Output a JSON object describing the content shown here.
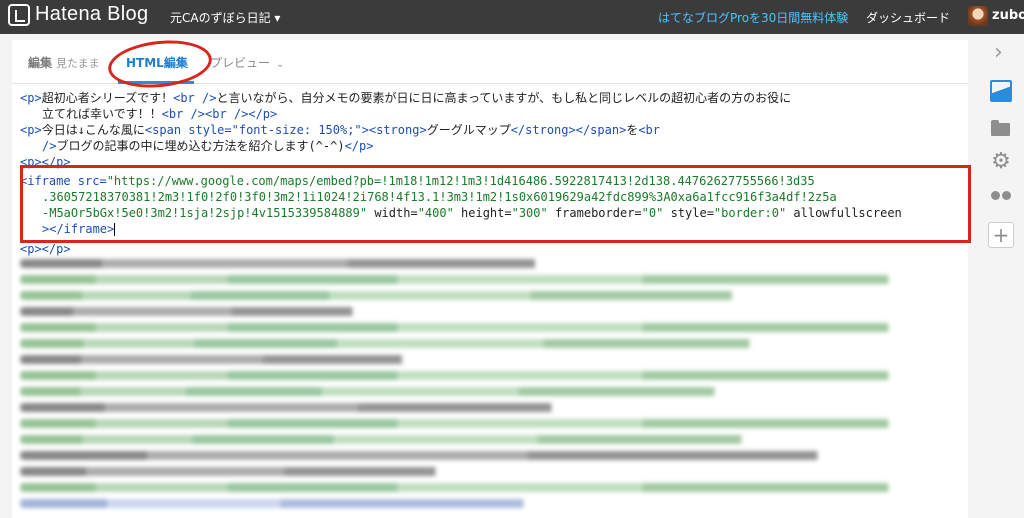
{
  "topbar": {
    "logo_text": "Hatena Blog",
    "blog_name": "元CAのずぼら日記 ▾",
    "pro_link": "はてなブログProを30日間無料体験",
    "dashboard": "ダッシュボード",
    "user_name": "zubor"
  },
  "tabs": {
    "edit_label": "編集",
    "edit_sub": "見たまま",
    "html_label": "HTML編集",
    "preview_label": "プレビュー",
    "preview_chevron": "⌄"
  },
  "code": {
    "l1a": "<p>",
    "l1b": "超初心者シリーズです！",
    "l1c": "<br />",
    "l1d": "と言いながら、自分メモの要素が日に日に高まっていますが、もし私と同じレベルの超初心者の方のお役に",
    "l2a": "立てれば幸いです！！",
    "l2b": "<br /><br /></p>",
    "l3a": "<p>",
    "l3b": "今日は↓こんな風に",
    "l3c": "<span style=\"font-size: 150%;\"><strong>",
    "l3d": "グーグルマップ",
    "l3e": "</strong></span>",
    "l3f": "を",
    "l3g": "<br",
    "l4a": "/>",
    "l4b": "ブログの記事の中に埋め込む方法を紹介します(^-^)",
    "l4c": "</p>",
    "l5": "<p></p>",
    "l6a": "<iframe src=",
    "l6b": "\"https://www.google.com/maps/embed?pb=!1m18!1m12!1m3!1d416486.5922817413!2d138.44762627755566!3d35",
    "l7": ".36057218370381!2m3!1f0!2f0!3f0!3m2!1i1024!2i768!4f13.1!3m3!1m2!1s0x6019629a42fdc899%3A0xa6a1fcc916f3a4df!2z5a",
    "l8a": "-M5aOr5bGx!5e0!3m2!1sja!2sjp!4v1515339584889\"",
    "l8b": " width=",
    "l8c": "\"400\"",
    "l8d": " height=",
    "l8e": "\"300\"",
    "l8f": " frameborder=",
    "l8g": "\"0\"",
    "l8h": " style=",
    "l8i": "\"border:0\"",
    "l8j": " allowfullscreen",
    "l9": "></iframe>",
    "l10": "<p></p>"
  },
  "annotation_color": "#d7261b",
  "accent_color": "#2b8cdc",
  "sidebar_icons": [
    "chevron-right-icon",
    "image-icon",
    "folder-icon",
    "gear-icon",
    "dots-icon",
    "plus-icon"
  ]
}
